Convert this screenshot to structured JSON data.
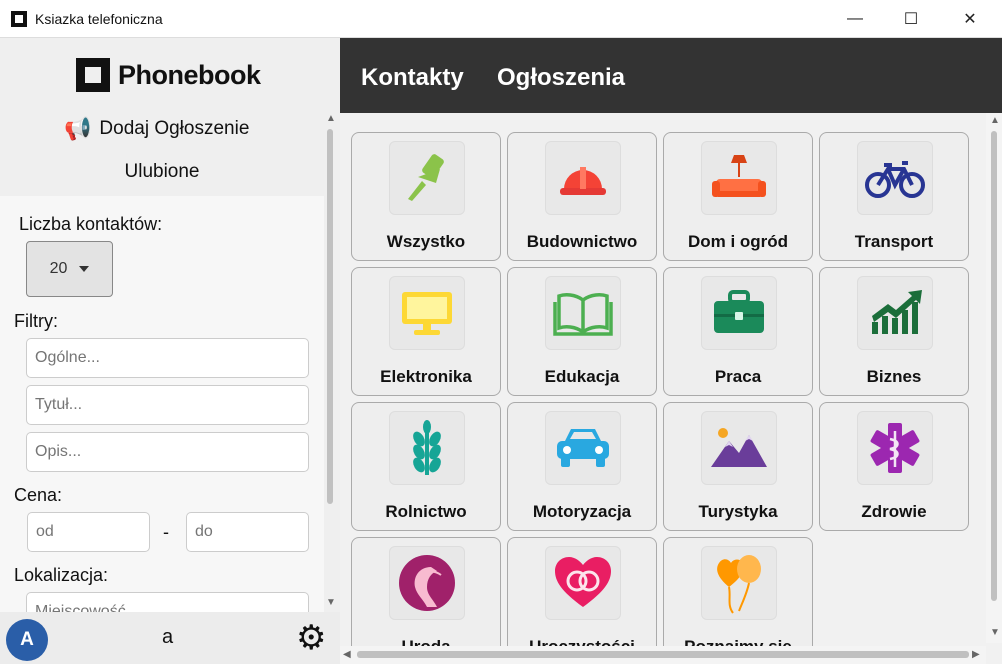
{
  "window": {
    "title": "Ksiazka telefoniczna",
    "minimize": "—",
    "maximize": "☐",
    "close": "✕"
  },
  "sidebar": {
    "logo_text": "Phonebook",
    "add_ad": "Dodaj Ogłoszenie",
    "favorites": "Ulubione",
    "contact_count_label": "Liczba kontaktów:",
    "contact_count_value": "20",
    "filters_label": "Filtry:",
    "general_placeholder": "Ogólne...",
    "title_placeholder": "Tytuł...",
    "desc_placeholder": "Opis...",
    "price_label": "Cena:",
    "price_from_placeholder": "od",
    "price_sep": "-",
    "price_to_placeholder": "do",
    "location_label": "Lokalizacja:",
    "city_placeholder": "Miejscowość..."
  },
  "footer": {
    "avatar_letter": "A",
    "username": "a"
  },
  "header": {
    "tabs": [
      "Kontakty",
      "Ogłoszenia"
    ]
  },
  "categories": [
    {
      "label": "Wszystko",
      "icon": "pushpin-icon",
      "color": "#8bc34a"
    },
    {
      "label": "Budownictwo",
      "icon": "hard-hat-icon",
      "color": "#f44336"
    },
    {
      "label": "Dom i ogród",
      "icon": "sofa-lamp-icon",
      "color": "#ff5722"
    },
    {
      "label": "Transport",
      "icon": "bicycle-icon",
      "color": "#283593"
    },
    {
      "label": "Elektronika",
      "icon": "monitor-icon",
      "color": "#ffeb3b"
    },
    {
      "label": "Edukacja",
      "icon": "open-book-icon",
      "color": "#4caf50"
    },
    {
      "label": "Praca",
      "icon": "briefcase-icon",
      "color": "#1b8a5a"
    },
    {
      "label": "Biznes",
      "icon": "growth-chart-icon",
      "color": "#1b6e3a"
    },
    {
      "label": "Rolnictwo",
      "icon": "wheat-icon",
      "color": "#16a596"
    },
    {
      "label": "Motoryzacja",
      "icon": "car-icon",
      "color": "#29a8e0"
    },
    {
      "label": "Turystyka",
      "icon": "mountains-icon",
      "color": "#6a3d9a"
    },
    {
      "label": "Zdrowie",
      "icon": "medical-star-icon",
      "color": "#9c27b0"
    },
    {
      "label": "Uroda",
      "icon": "woman-face-icon",
      "color": "#a0216a"
    },
    {
      "label": "Uroczystości",
      "icon": "rings-heart-icon",
      "color": "#e91e63"
    },
    {
      "label": "Poznajmy się",
      "icon": "balloons-icon",
      "color": "#ff9800"
    }
  ]
}
